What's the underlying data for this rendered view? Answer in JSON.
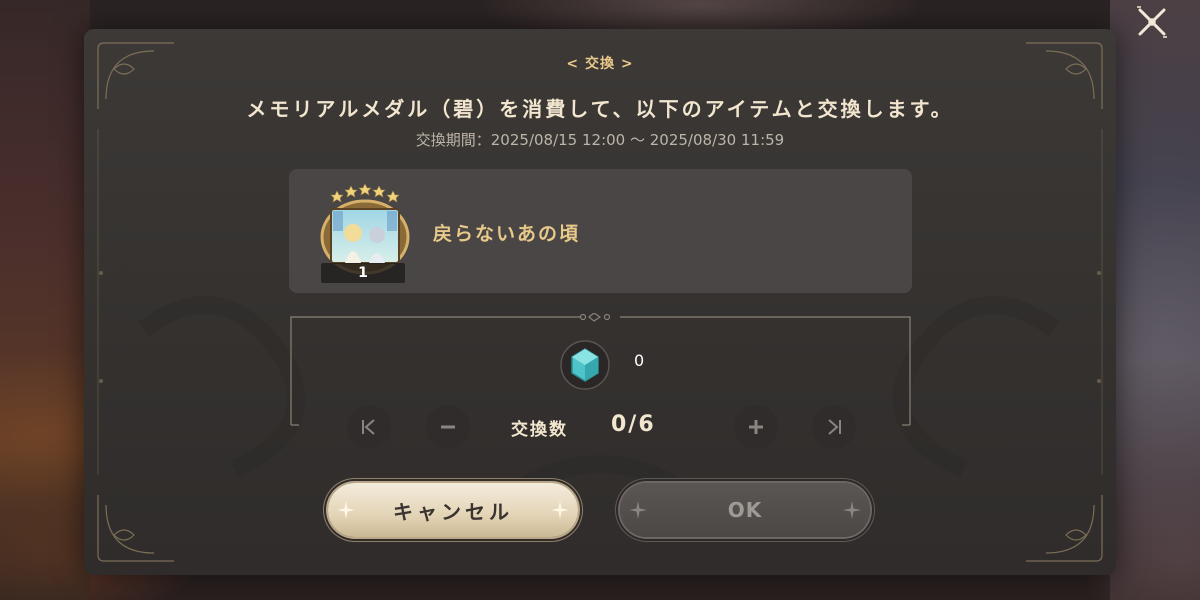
{
  "dialog": {
    "header_tag": "< 交換 >",
    "headline": "メモリアルメダル（碧）を消費して、以下のアイテムと交換します。",
    "period": "交換期間：2025/08/15 12:00 ～ 2025/08/30 11:59"
  },
  "item": {
    "name": "戻らないあの頃",
    "count": "1",
    "stars": 5
  },
  "currency": {
    "icon": "blue-medal-icon",
    "owned": "0"
  },
  "exchange": {
    "label": "交換数",
    "value": "0/6"
  },
  "buttons": {
    "cancel": "キャンセル",
    "ok": "OK"
  },
  "colors": {
    "accent_gold": "#e8c98a",
    "panel_bg": "#3a3735",
    "medal_teal": "#4fc4c8"
  }
}
